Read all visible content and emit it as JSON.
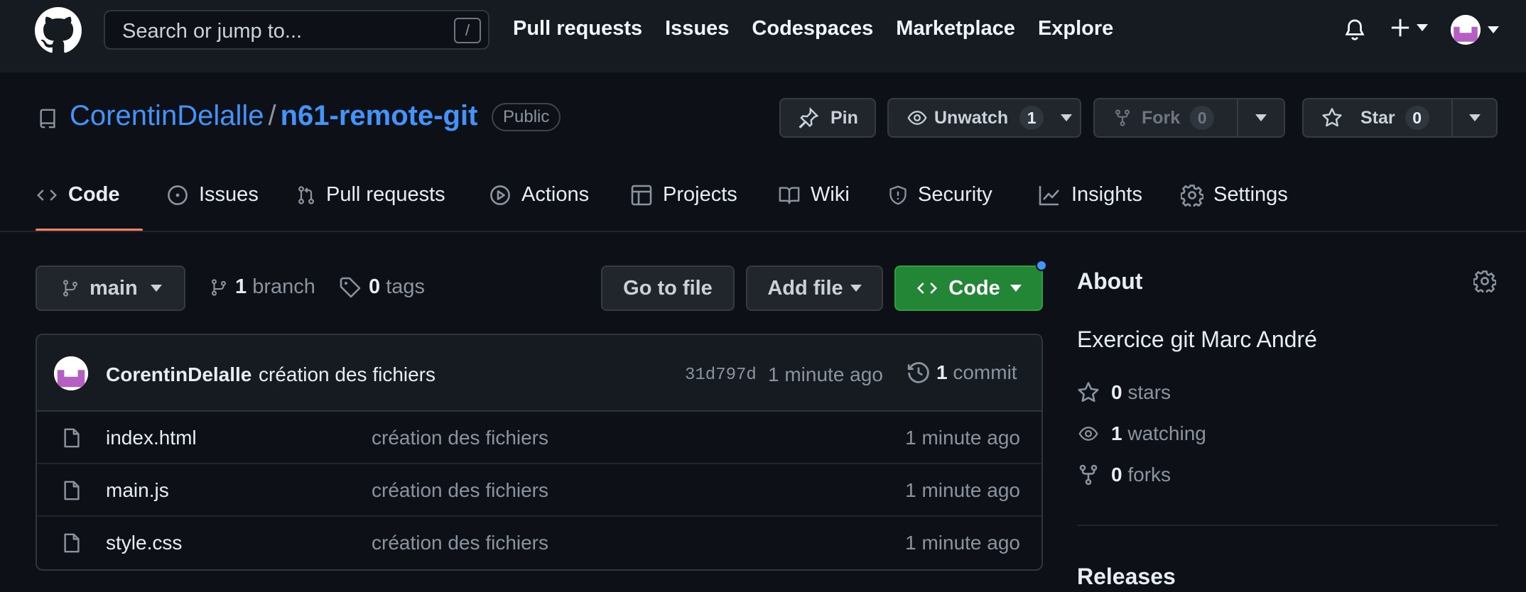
{
  "header": {
    "search_placeholder": "Search or jump to...",
    "search_shortcut": "/",
    "nav": [
      "Pull requests",
      "Issues",
      "Codespaces",
      "Marketplace",
      "Explore"
    ]
  },
  "repo": {
    "owner": "CorentinDelalle",
    "separator": "/",
    "name": "n61-remote-git",
    "visibility": "Public",
    "pin_label": "Pin",
    "unwatch_label": "Unwatch",
    "unwatch_count": "1",
    "fork_label": "Fork",
    "fork_count": "0",
    "star_label": "Star",
    "star_count": "0"
  },
  "tabs": [
    {
      "label": "Code",
      "icon": "code-icon",
      "active": true
    },
    {
      "label": "Issues",
      "icon": "issue-icon"
    },
    {
      "label": "Pull requests",
      "icon": "pull-request-icon"
    },
    {
      "label": "Actions",
      "icon": "play-icon"
    },
    {
      "label": "Projects",
      "icon": "table-icon"
    },
    {
      "label": "Wiki",
      "icon": "book-icon"
    },
    {
      "label": "Security",
      "icon": "shield-icon"
    },
    {
      "label": "Insights",
      "icon": "graph-icon"
    },
    {
      "label": "Settings",
      "icon": "gear-icon"
    }
  ],
  "toolbar": {
    "branch_name": "main",
    "branch_count": "1",
    "branch_label": "branch",
    "tag_count": "0",
    "tag_label": "tags",
    "go_to_file": "Go to file",
    "add_file": "Add file",
    "code": "Code"
  },
  "commit": {
    "author": "CorentinDelalle",
    "message": "création des fichiers",
    "sha": "31d797d",
    "time": "1 minute ago",
    "count": "1",
    "count_label": "commit"
  },
  "files": [
    {
      "name": "index.html",
      "message": "création des fichiers",
      "time": "1 minute ago"
    },
    {
      "name": "main.js",
      "message": "création des fichiers",
      "time": "1 minute ago"
    },
    {
      "name": "style.css",
      "message": "création des fichiers",
      "time": "1 minute ago"
    }
  ],
  "about": {
    "title": "About",
    "description": "Exercice git Marc André",
    "stars_count": "0",
    "stars_label": "stars",
    "watching_count": "1",
    "watching_label": "watching",
    "forks_count": "0",
    "forks_label": "forks",
    "releases_title": "Releases"
  },
  "colors": {
    "background": "#0d1117",
    "header": "#161b22",
    "link": "#4493f8",
    "code_button": "#238636",
    "active_tab": "#f78166"
  }
}
